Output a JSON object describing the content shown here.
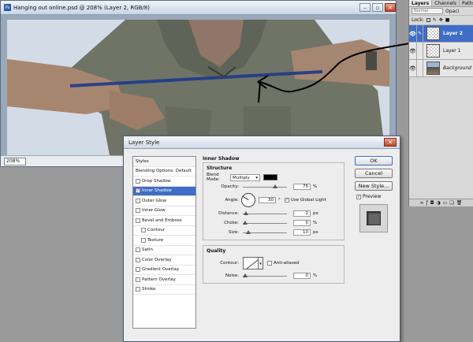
{
  "document": {
    "title": "Hanging out online.psd @ 208% (Layer 2, RGB/8)",
    "app_icon": "Ps",
    "zoom": "208%"
  },
  "layers_panel": {
    "tabs": [
      "Layers",
      "Channels",
      "Paths"
    ],
    "blend_mode": "Normal",
    "opacity_label": "Opaci",
    "lock_label": "Lock:",
    "layers": [
      {
        "name": "Layer 2",
        "selected": true,
        "italic": false
      },
      {
        "name": "Layer 1",
        "selected": false,
        "italic": false
      },
      {
        "name": "Background",
        "selected": false,
        "italic": true
      }
    ]
  },
  "dialog": {
    "title": "Layer Style",
    "close_glyph": "✕",
    "styles_header": "Styles",
    "blending_options": "Blending Options: Default",
    "styles": [
      {
        "label": "Drop Shadow",
        "checked": false,
        "indent": false,
        "active": false
      },
      {
        "label": "Inner Shadow",
        "checked": true,
        "indent": false,
        "active": true
      },
      {
        "label": "Outer Glow",
        "checked": false,
        "indent": false,
        "active": false
      },
      {
        "label": "Inner Glow",
        "checked": false,
        "indent": false,
        "active": false
      },
      {
        "label": "Bevel and Emboss",
        "checked": false,
        "indent": false,
        "active": false
      },
      {
        "label": "Contour",
        "checked": false,
        "indent": true,
        "active": false
      },
      {
        "label": "Texture",
        "checked": false,
        "indent": true,
        "active": false
      },
      {
        "label": "Satin",
        "checked": false,
        "indent": false,
        "active": false
      },
      {
        "label": "Color Overlay",
        "checked": false,
        "indent": false,
        "active": false
      },
      {
        "label": "Gradient Overlay",
        "checked": false,
        "indent": false,
        "active": false
      },
      {
        "label": "Pattern Overlay",
        "checked": false,
        "indent": false,
        "active": false
      },
      {
        "label": "Stroke",
        "checked": false,
        "indent": false,
        "active": false
      }
    ],
    "section_title": "Inner Shadow",
    "structure": {
      "title": "Structure",
      "blend_mode_label": "Blend Mode:",
      "blend_mode": "Multiply",
      "shadow_color": "#000000",
      "opacity_label": "Opacity:",
      "opacity": "75",
      "opacity_fraction": 0.75,
      "angle_label": "Angle:",
      "angle": "30",
      "degree": "°",
      "use_global_light": "Use Global Light",
      "distance_label": "Distance:",
      "distance": "2",
      "distance_fraction": 0.02,
      "choke_label": "Choke:",
      "choke": "0",
      "choke_fraction": 0.0,
      "size_label": "Size:",
      "size": "10",
      "size_fraction": 0.07,
      "unit_px": "px",
      "unit_pct": "%"
    },
    "quality": {
      "title": "Quality",
      "contour_label": "Contour:",
      "anti_aliased": "Anti-aliased",
      "noise_label": "Noise:",
      "noise": "0",
      "noise_fraction": 0.0
    },
    "buttons": {
      "ok": "OK",
      "cancel": "Cancel",
      "new_style": "New Style...",
      "preview": "Preview"
    }
  }
}
